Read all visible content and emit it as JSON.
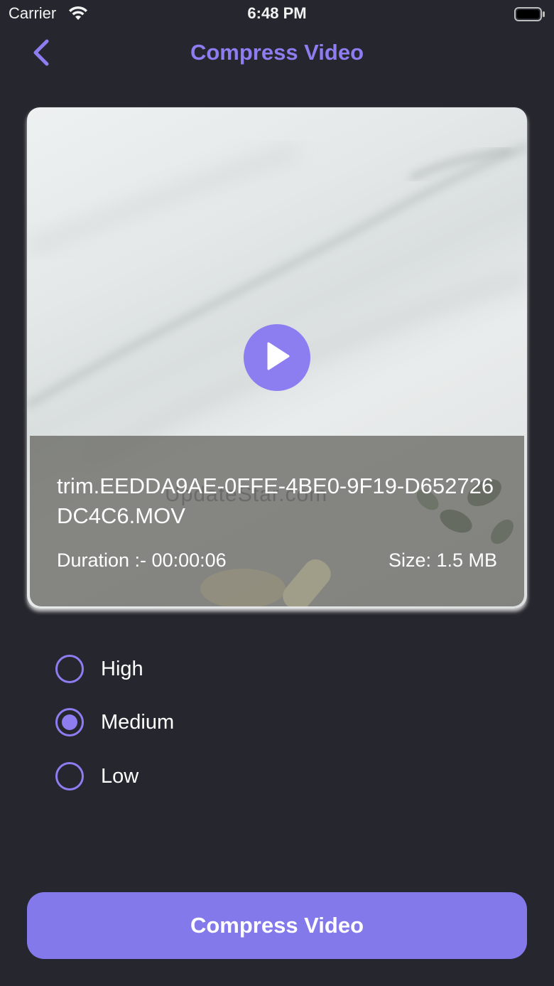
{
  "status_bar": {
    "carrier": "Carrier",
    "time": "6:48 PM"
  },
  "nav": {
    "title": "Compress Video",
    "back_icon": "chevron-left-icon"
  },
  "video": {
    "file_name": "trim.EEDDA9AE-0FFE-4BE0-9F19-D652726DC4C6.MOV",
    "duration": "Duration :- 00:00:06",
    "size": "Size: 1.5 MB",
    "watermark": "UpdateStar.com",
    "play_icon": "play-icon"
  },
  "quality_options": [
    {
      "label": "High",
      "selected": false
    },
    {
      "label": "Medium",
      "selected": true
    },
    {
      "label": "Low",
      "selected": false
    }
  ],
  "action": {
    "compress_label": "Compress Video"
  },
  "colors": {
    "background": "#26262e",
    "accent": "#8c7df0",
    "button": "#8479ea"
  }
}
